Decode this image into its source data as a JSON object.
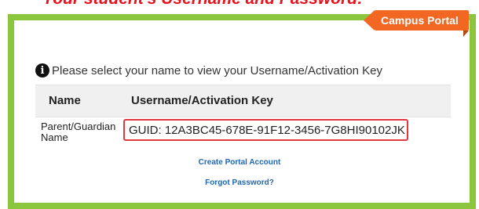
{
  "caption": "Your student's Username and Password:",
  "portal_tab": {
    "label": "Campus Portal"
  },
  "info": {
    "icon": "info-icon",
    "message": "Please select your name to view your Username/Activation Key"
  },
  "table": {
    "headers": [
      "Name",
      "Username/Activation Key"
    ],
    "rows": [
      {
        "name": "Parent/Guardian Name",
        "key": "GUID: 12A3BC45-678E-91F12-3456-7G8HI90102JK"
      }
    ]
  },
  "links": {
    "create": "Create Portal Account",
    "forgot": "Forgot Password?"
  },
  "colors": {
    "frame_green": "#8cc63f",
    "tab_orange": "#f26722",
    "highlight_red": "#e0383e",
    "link_blue": "#1f67b1"
  }
}
